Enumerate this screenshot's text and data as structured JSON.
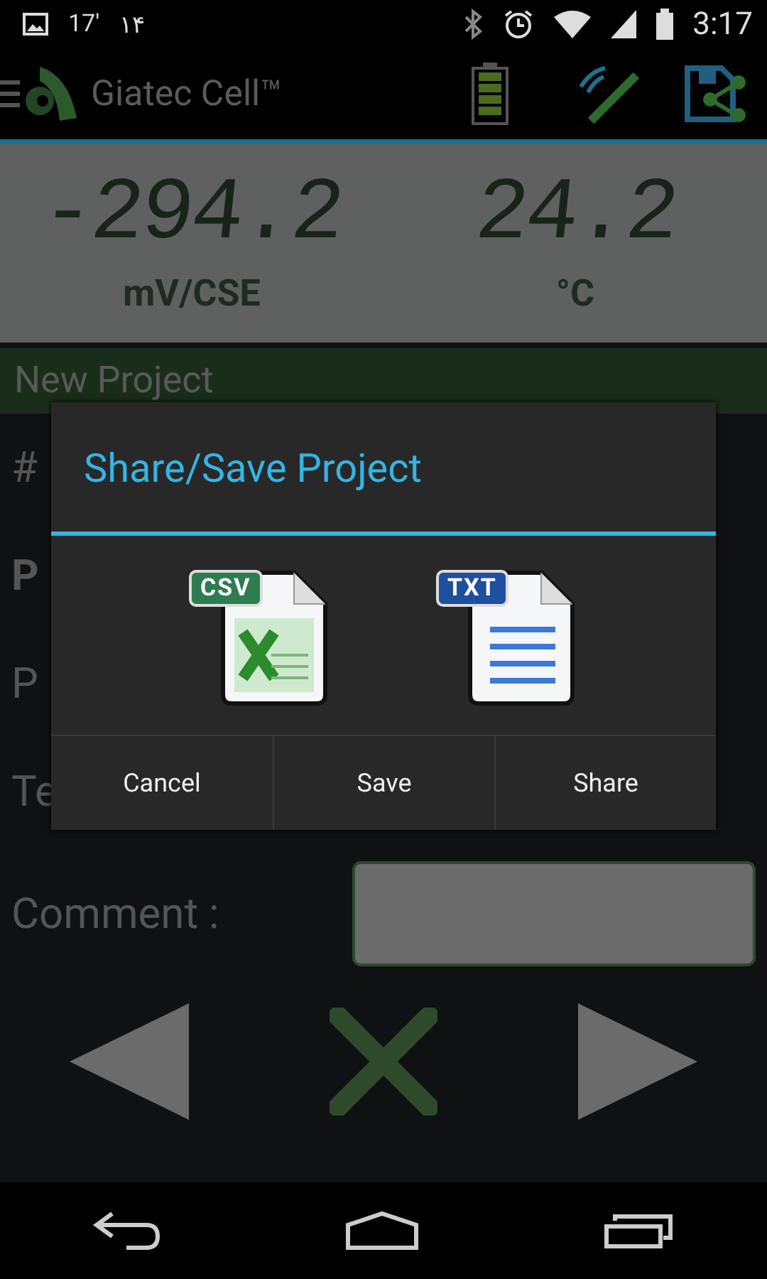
{
  "status_bar": {
    "left_texts": [
      "17'",
      "۱۴"
    ],
    "time": "3:17"
  },
  "app_bar": {
    "title": "Giatec Cell™"
  },
  "readings": [
    {
      "value": "-294.2",
      "unit": "mV/CSE"
    },
    {
      "value": "24.2",
      "unit": "°C"
    }
  ],
  "project_bar": {
    "title": "New Project"
  },
  "form_rows": [
    {
      "label": "#",
      "bold": false
    },
    {
      "label": "P",
      "bold": true
    },
    {
      "label": "P",
      "bold": false
    },
    {
      "label": "Te",
      "bold": false
    }
  ],
  "comment": {
    "label": "Comment :"
  },
  "dialog": {
    "title": "Share/Save Project",
    "formats": [
      {
        "kind": "csv",
        "label": "CSV"
      },
      {
        "kind": "txt",
        "label": "TXT"
      }
    ],
    "buttons": [
      "Cancel",
      "Save",
      "Share"
    ]
  }
}
